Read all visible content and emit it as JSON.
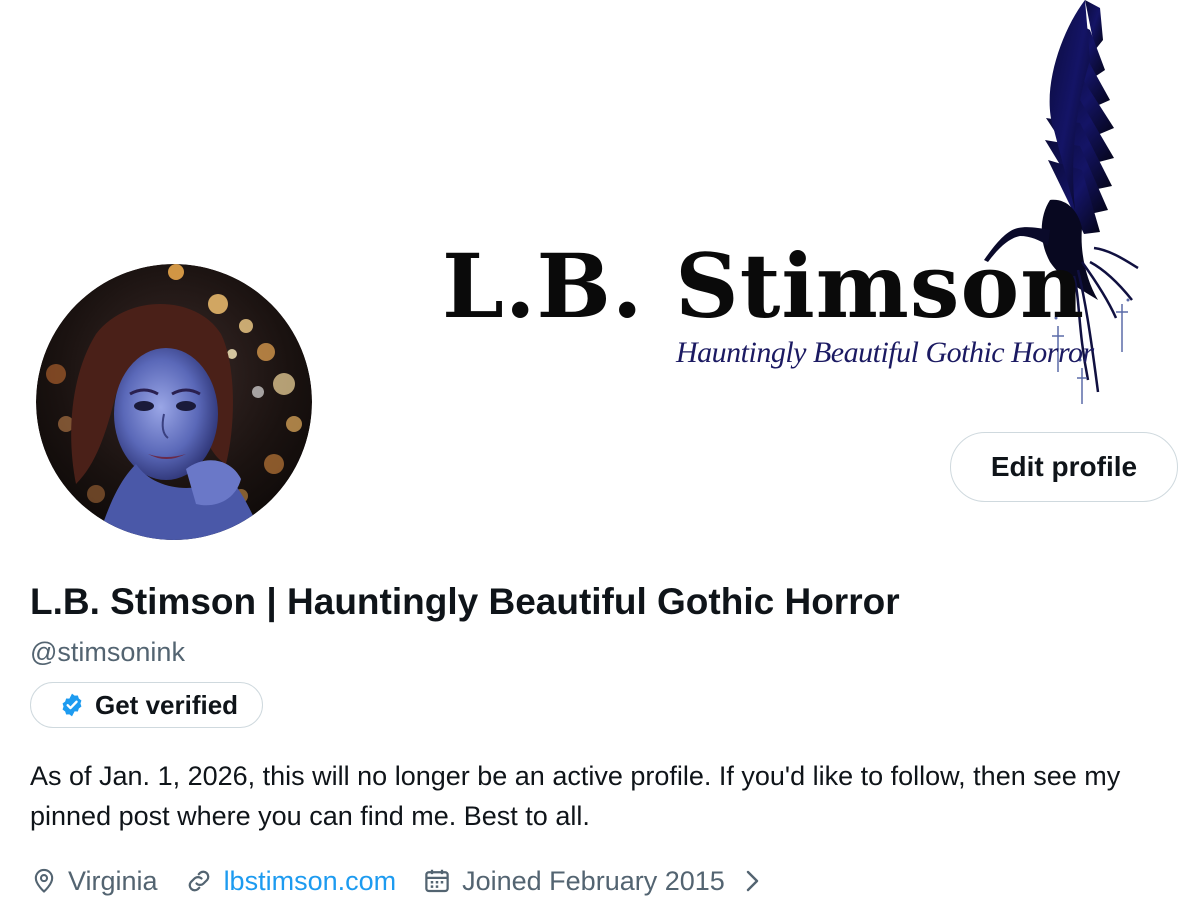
{
  "banner": {
    "title": "L.B. Stimson",
    "tagline": "Hauntingly Beautiful Gothic Horror"
  },
  "profile": {
    "display_name": "L.B. Stimson | Hauntingly Beautiful Gothic Horror",
    "handle": "@stimsonink",
    "bio": "As of Jan. 1, 2026, this will no longer be an active profile. If you'd like to follow, then see my pinned post where you can find me. Best to all."
  },
  "buttons": {
    "edit_profile": "Edit profile",
    "get_verified": "Get verified"
  },
  "meta": {
    "location": "Virginia",
    "website": "lbstimson.com",
    "joined": "Joined February 2015"
  },
  "icons": {
    "location": "map-pin-icon",
    "website": "link-icon",
    "joined": "calendar-icon",
    "verified": "verified-badge-icon",
    "chevron": "chevron-right-icon"
  },
  "colors": {
    "link": "#1d9bf0",
    "verified": "#1d9bf0",
    "secondary_text": "#536471",
    "primary_text": "#0f1419",
    "border": "#cfd9de"
  }
}
